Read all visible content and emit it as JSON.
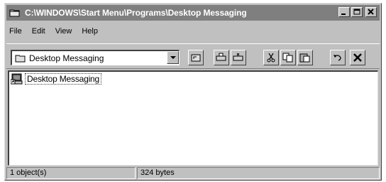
{
  "window": {
    "title": "C:\\WINDOWS\\Start Menu\\Programs\\Desktop Messaging",
    "minimize_icon": "minimize-icon",
    "maximize_icon": "maximize-icon",
    "close_icon": "close-icon"
  },
  "menu": [
    {
      "label": "File"
    },
    {
      "label": "Edit"
    },
    {
      "label": "View"
    },
    {
      "label": "Help"
    }
  ],
  "toolbar": {
    "address_value": "Desktop Messaging",
    "buttons": [
      "up-one-level-icon",
      "map-drive-icon",
      "disconnect-icon",
      "cut-icon",
      "copy-icon",
      "paste-icon",
      "undo-icon",
      "delete-icon"
    ]
  },
  "content": {
    "items": [
      {
        "label": "Desktop Messaging",
        "icon": "shortcut-icon"
      }
    ]
  },
  "status": {
    "objects": "1 object(s)",
    "size": "324 bytes"
  },
  "colors": {
    "face": "#c0c0c0",
    "title_inactive": "#7f7f7f"
  }
}
